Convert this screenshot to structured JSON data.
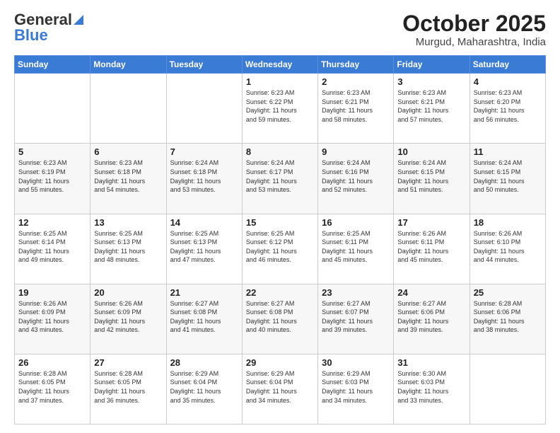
{
  "header": {
    "logo_general": "General",
    "logo_blue": "Blue",
    "month_title": "October 2025",
    "location": "Murgud, Maharashtra, India"
  },
  "days_of_week": [
    "Sunday",
    "Monday",
    "Tuesday",
    "Wednesday",
    "Thursday",
    "Friday",
    "Saturday"
  ],
  "weeks": [
    [
      null,
      null,
      null,
      {
        "num": "1",
        "sunrise": "6:23 AM",
        "sunset": "6:22 PM",
        "daylight": "11 hours and 59 minutes."
      },
      {
        "num": "2",
        "sunrise": "6:23 AM",
        "sunset": "6:21 PM",
        "daylight": "11 hours and 58 minutes."
      },
      {
        "num": "3",
        "sunrise": "6:23 AM",
        "sunset": "6:21 PM",
        "daylight": "11 hours and 57 minutes."
      },
      {
        "num": "4",
        "sunrise": "6:23 AM",
        "sunset": "6:20 PM",
        "daylight": "11 hours and 56 minutes."
      }
    ],
    [
      {
        "num": "5",
        "sunrise": "6:23 AM",
        "sunset": "6:19 PM",
        "daylight": "11 hours and 55 minutes."
      },
      {
        "num": "6",
        "sunrise": "6:23 AM",
        "sunset": "6:18 PM",
        "daylight": "11 hours and 54 minutes."
      },
      {
        "num": "7",
        "sunrise": "6:24 AM",
        "sunset": "6:18 PM",
        "daylight": "11 hours and 53 minutes."
      },
      {
        "num": "8",
        "sunrise": "6:24 AM",
        "sunset": "6:17 PM",
        "daylight": "11 hours and 53 minutes."
      },
      {
        "num": "9",
        "sunrise": "6:24 AM",
        "sunset": "6:16 PM",
        "daylight": "11 hours and 52 minutes."
      },
      {
        "num": "10",
        "sunrise": "6:24 AM",
        "sunset": "6:15 PM",
        "daylight": "11 hours and 51 minutes."
      },
      {
        "num": "11",
        "sunrise": "6:24 AM",
        "sunset": "6:15 PM",
        "daylight": "11 hours and 50 minutes."
      }
    ],
    [
      {
        "num": "12",
        "sunrise": "6:25 AM",
        "sunset": "6:14 PM",
        "daylight": "11 hours and 49 minutes."
      },
      {
        "num": "13",
        "sunrise": "6:25 AM",
        "sunset": "6:13 PM",
        "daylight": "11 hours and 48 minutes."
      },
      {
        "num": "14",
        "sunrise": "6:25 AM",
        "sunset": "6:13 PM",
        "daylight": "11 hours and 47 minutes."
      },
      {
        "num": "15",
        "sunrise": "6:25 AM",
        "sunset": "6:12 PM",
        "daylight": "11 hours and 46 minutes."
      },
      {
        "num": "16",
        "sunrise": "6:25 AM",
        "sunset": "6:11 PM",
        "daylight": "11 hours and 45 minutes."
      },
      {
        "num": "17",
        "sunrise": "6:26 AM",
        "sunset": "6:11 PM",
        "daylight": "11 hours and 45 minutes."
      },
      {
        "num": "18",
        "sunrise": "6:26 AM",
        "sunset": "6:10 PM",
        "daylight": "11 hours and 44 minutes."
      }
    ],
    [
      {
        "num": "19",
        "sunrise": "6:26 AM",
        "sunset": "6:09 PM",
        "daylight": "11 hours and 43 minutes."
      },
      {
        "num": "20",
        "sunrise": "6:26 AM",
        "sunset": "6:09 PM",
        "daylight": "11 hours and 42 minutes."
      },
      {
        "num": "21",
        "sunrise": "6:27 AM",
        "sunset": "6:08 PM",
        "daylight": "11 hours and 41 minutes."
      },
      {
        "num": "22",
        "sunrise": "6:27 AM",
        "sunset": "6:08 PM",
        "daylight": "11 hours and 40 minutes."
      },
      {
        "num": "23",
        "sunrise": "6:27 AM",
        "sunset": "6:07 PM",
        "daylight": "11 hours and 39 minutes."
      },
      {
        "num": "24",
        "sunrise": "6:27 AM",
        "sunset": "6:06 PM",
        "daylight": "11 hours and 39 minutes."
      },
      {
        "num": "25",
        "sunrise": "6:28 AM",
        "sunset": "6:06 PM",
        "daylight": "11 hours and 38 minutes."
      }
    ],
    [
      {
        "num": "26",
        "sunrise": "6:28 AM",
        "sunset": "6:05 PM",
        "daylight": "11 hours and 37 minutes."
      },
      {
        "num": "27",
        "sunrise": "6:28 AM",
        "sunset": "6:05 PM",
        "daylight": "11 hours and 36 minutes."
      },
      {
        "num": "28",
        "sunrise": "6:29 AM",
        "sunset": "6:04 PM",
        "daylight": "11 hours and 35 minutes."
      },
      {
        "num": "29",
        "sunrise": "6:29 AM",
        "sunset": "6:04 PM",
        "daylight": "11 hours and 34 minutes."
      },
      {
        "num": "30",
        "sunrise": "6:29 AM",
        "sunset": "6:03 PM",
        "daylight": "11 hours and 34 minutes."
      },
      {
        "num": "31",
        "sunrise": "6:30 AM",
        "sunset": "6:03 PM",
        "daylight": "11 hours and 33 minutes."
      },
      null
    ]
  ],
  "labels": {
    "sunrise_label": "Sunrise:",
    "sunset_label": "Sunset:",
    "daylight_label": "Daylight:"
  }
}
